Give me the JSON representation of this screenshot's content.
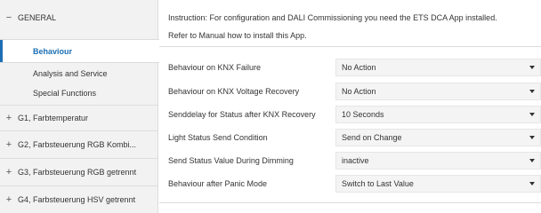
{
  "sidebar": {
    "general": {
      "sign": "−",
      "label": "GENERAL"
    },
    "subitems": [
      {
        "label": "Behaviour",
        "active": true
      },
      {
        "label": "Analysis and Service",
        "active": false
      },
      {
        "label": "Special Functions",
        "active": false
      }
    ],
    "groups": [
      {
        "sign": "+",
        "label": "G1, Farbtemperatur"
      },
      {
        "sign": "+",
        "label": "G2, Farbsteuerung RGB Kombi..."
      },
      {
        "sign": "+",
        "label": "G3, Farbsteuerung RGB getrennt"
      },
      {
        "sign": "+",
        "label": "G4, Farbsteuerung HSV getrennt"
      }
    ]
  },
  "main": {
    "instruction": [
      "Instruction: For configuration and DALI Commissioning you need the ETS DCA App installed.",
      "Refer to Manual how to install this App."
    ],
    "parameters": [
      {
        "label": "Behaviour on KNX Failure",
        "value": "No Action"
      },
      {
        "label": "Behaviour on KNX Voltage Recovery",
        "value": "No Action"
      },
      {
        "label": "Senddelay for Status after KNX Recovery",
        "value": "10 Seconds"
      },
      {
        "label": "Light Status Send  Condition",
        "value": "Send on Change"
      },
      {
        "label": "Send Status Value During Dimming",
        "value": "inactive"
      },
      {
        "label": "Behaviour after Panic Mode",
        "value": "Switch to Last Value"
      }
    ]
  },
  "colors": {
    "accent": "#1d6fb5",
    "sidebar_bg": "#f2f2f2",
    "select_bg": "#f4f4f4",
    "border": "#dcdcdc"
  }
}
